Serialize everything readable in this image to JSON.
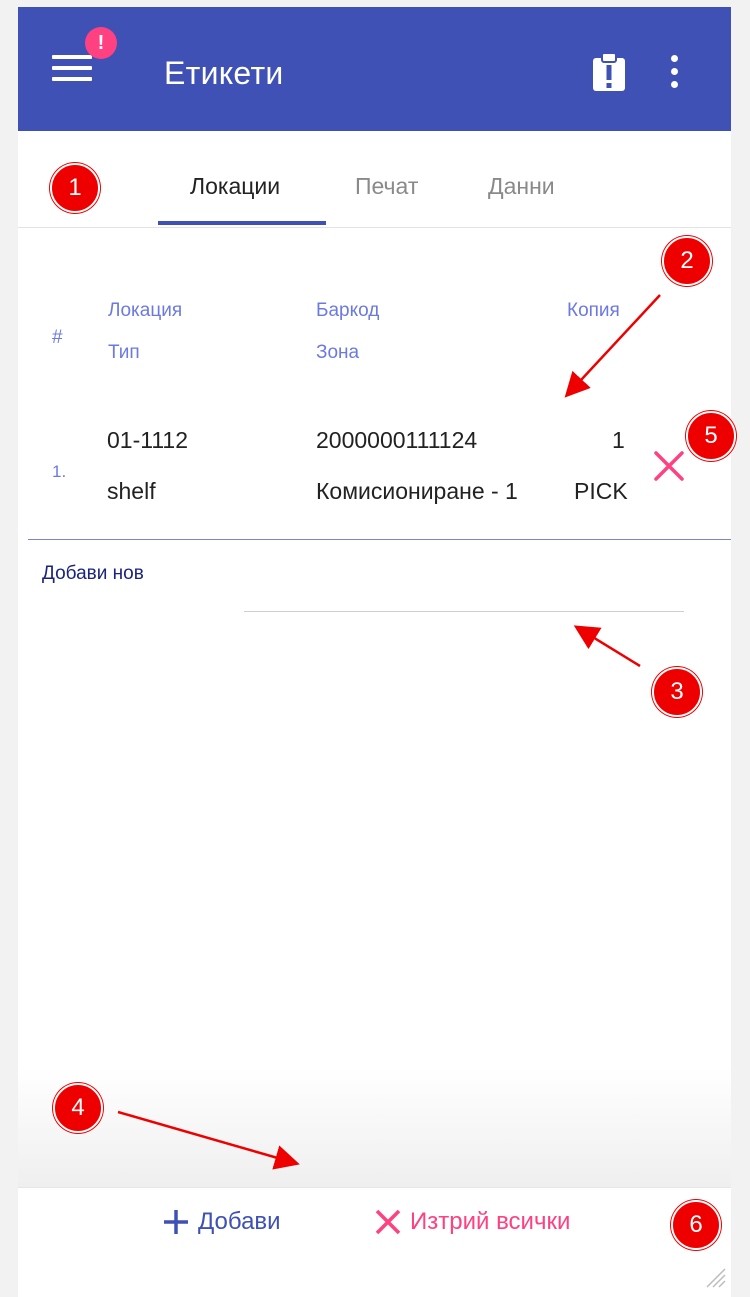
{
  "header": {
    "title": "Етикети",
    "badge": "!",
    "icons": [
      "menu-icon",
      "clipboard-alert-icon",
      "more-vert-icon"
    ],
    "color": "#3f51b5"
  },
  "tabs": [
    {
      "label": "Локации",
      "active": true
    },
    {
      "label": "Печат",
      "active": false
    },
    {
      "label": "Данни",
      "active": false
    }
  ],
  "table": {
    "headers": {
      "num": "#",
      "location": "Локация",
      "type": "Тип",
      "barcode": "Баркод",
      "zone": "Зона",
      "copies": "Копия"
    },
    "rows": [
      {
        "num": "1.",
        "location": "01-1112",
        "type": "shelf",
        "barcode": "2000000111124",
        "zone": "Комисиониране - 1",
        "copies": "1",
        "zone_code": "PICK"
      }
    ]
  },
  "add_new": {
    "label": "Добави нов",
    "value": ""
  },
  "footer": {
    "add_label": "Добави",
    "clear_label": "Изтрий всички"
  },
  "markers": [
    "1",
    "2",
    "3",
    "4",
    "5",
    "6"
  ],
  "colors": {
    "primary": "#3f51b5",
    "accent": "#ff4081",
    "marker": "#ee0000"
  }
}
